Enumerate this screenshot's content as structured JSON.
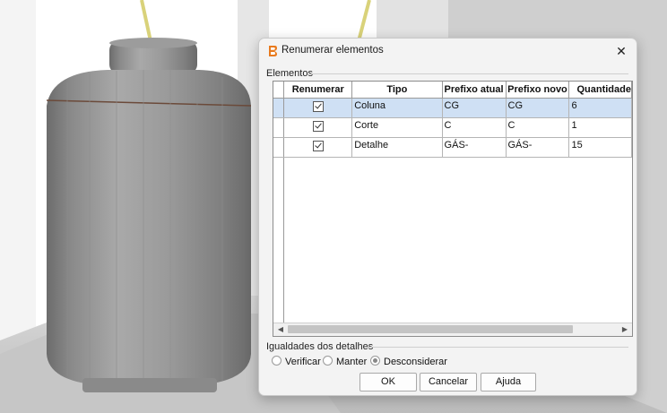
{
  "dialog": {
    "title": "Renumerar elementos",
    "group_elements_label": "Elementos",
    "table": {
      "columns": [
        "Renumerar",
        "Tipo",
        "Prefixo atual",
        "Prefixo novo",
        "Quantidade"
      ],
      "rows": [
        {
          "renumerar": true,
          "tipo": "Coluna",
          "prefixo_atual": "CG",
          "prefixo_novo": "CG",
          "quantidade": "6",
          "selected": true
        },
        {
          "renumerar": true,
          "tipo": "Corte",
          "prefixo_atual": "C",
          "prefixo_novo": "C",
          "quantidade": "1",
          "selected": false
        },
        {
          "renumerar": true,
          "tipo": "Detalhe",
          "prefixo_atual": "GÁS-",
          "prefixo_novo": "GÁS-",
          "quantidade": "15",
          "selected": false
        }
      ]
    },
    "group_details_label": "Igualdades dos detalhes",
    "radio_options": [
      {
        "label": "Verificar",
        "selected": false
      },
      {
        "label": "Manter",
        "selected": false
      },
      {
        "label": "Desconsiderar",
        "selected": true
      }
    ],
    "buttons": {
      "ok": "OK",
      "cancel": "Cancelar",
      "help": "Ajuda"
    }
  },
  "colors": {
    "selected_row": "#cfe0f4",
    "dialog_bg": "#f3f3f3",
    "app_icon": "#e87a1e"
  },
  "icons": {
    "app": "app-logo-icon",
    "close": "close-icon"
  }
}
